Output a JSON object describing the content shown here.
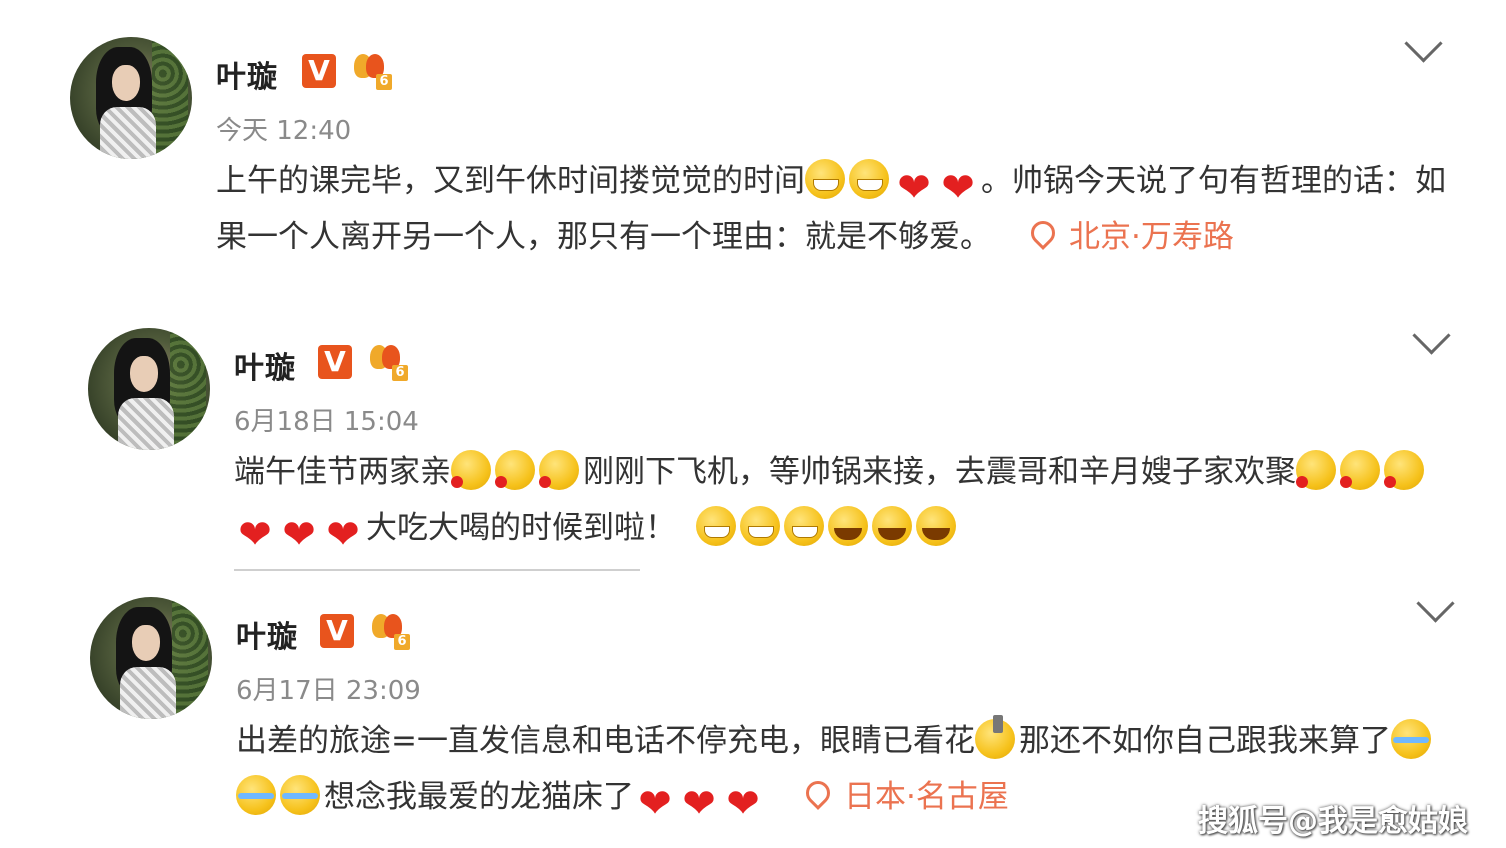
{
  "posts": [
    {
      "name": "叶璇",
      "v_badge": "V",
      "level": "6",
      "time": "今天 12:40",
      "text_a": "上午的课完毕，又到午休时间搂觉觉的时间",
      "text_b": "。帅锅今天说了句有哲理的话：如果一个人离开另一个人，那只有一个理由：就是不够爱。",
      "location": "北京·万寿路"
    },
    {
      "name": "叶璇",
      "v_badge": "V",
      "level": "6",
      "time": "6月18日 15:04",
      "text_a": "端午佳节两家亲",
      "text_b": "刚刚下飞机，等帅锅来接，去震哥和辛月嫂子家欢聚",
      "text_c": "大吃大喝的时候到啦！"
    },
    {
      "name": "叶璇",
      "v_badge": "V",
      "level": "6",
      "time": "6月17日 23:09",
      "text_a": "出差的旅途=一直发信息和电话不停充电，眼睛已看花",
      "text_b": "那还不如你自己跟我来算了",
      "text_c": "想念我最爱的龙猫床了",
      "location": "日本·名古屋"
    }
  ],
  "icons": {
    "heart": "❤"
  },
  "watermark": "搜狐号@我是愈姑娘"
}
